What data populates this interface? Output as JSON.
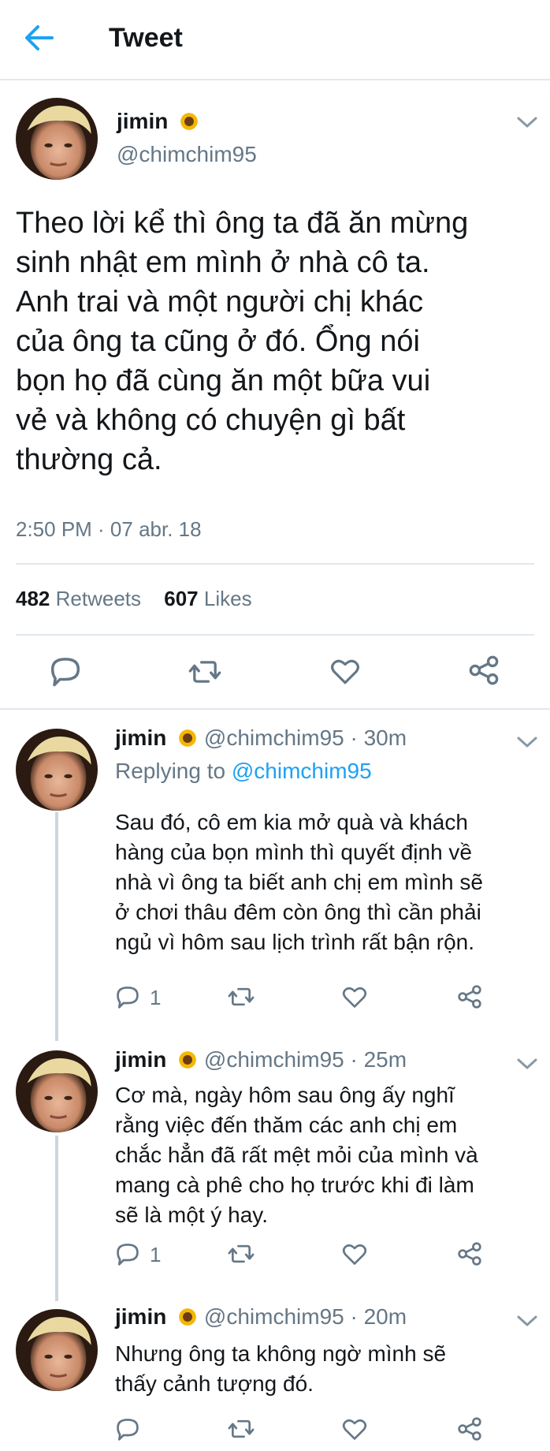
{
  "header": {
    "title": "Tweet"
  },
  "main_tweet": {
    "name": "jimin",
    "handle": "@chimchim95",
    "lines": [
      "Theo lời kể thì ông ta đã ăn mừng",
      "sinh nhật em mình ở nhà cô ta.",
      "Anh trai và một người chị khác",
      "của ông ta cũng ở đó. Ổng nói",
      "bọn họ đã cùng ăn một bữa vui",
      "vẻ và không có chuyện gì bất",
      "thường cả."
    ],
    "timestamp": "2:50 PM · 07 abr. 18",
    "retweet_count": "482",
    "retweet_label": "Retweets",
    "like_count": "607",
    "like_label": "Likes"
  },
  "replies": [
    {
      "name": "jimin",
      "meta": "@chimchim95 · 30m",
      "replying_prefix": "Replying to",
      "replying_handle": "@chimchim95",
      "lines": [
        "Sau đó, cô em kia mở quà và khách",
        "hàng của bọn mình thì quyết định về",
        "nhà vì ông ta biết anh chị em mình sẽ",
        "ở chơi thâu đêm còn ông thì cần phải",
        "ngủ vì hôm sau lịch trình rất bận rộn."
      ],
      "reply_count": "1"
    },
    {
      "name": "jimin",
      "meta": "@chimchim95 · 25m",
      "lines": [
        "Cơ mà, ngày hôm sau ông ấy nghĩ",
        "rằng việc đến thăm các anh chị em",
        "chắc hẳn đã rất mệt mỏi của mình và",
        "mang cà phê cho họ trước khi đi làm",
        "sẽ là một ý hay."
      ],
      "reply_count": "1"
    },
    {
      "name": "jimin",
      "meta": "@chimchim95 · 20m",
      "lines": [
        "Nhưng ông ta không ngờ mình sẽ",
        "thấy cảnh tượng đó."
      ],
      "reply_count": ""
    }
  ],
  "colors": {
    "accent": "#1da1f2",
    "muted": "#657786",
    "divider": "#e1e8ed"
  }
}
